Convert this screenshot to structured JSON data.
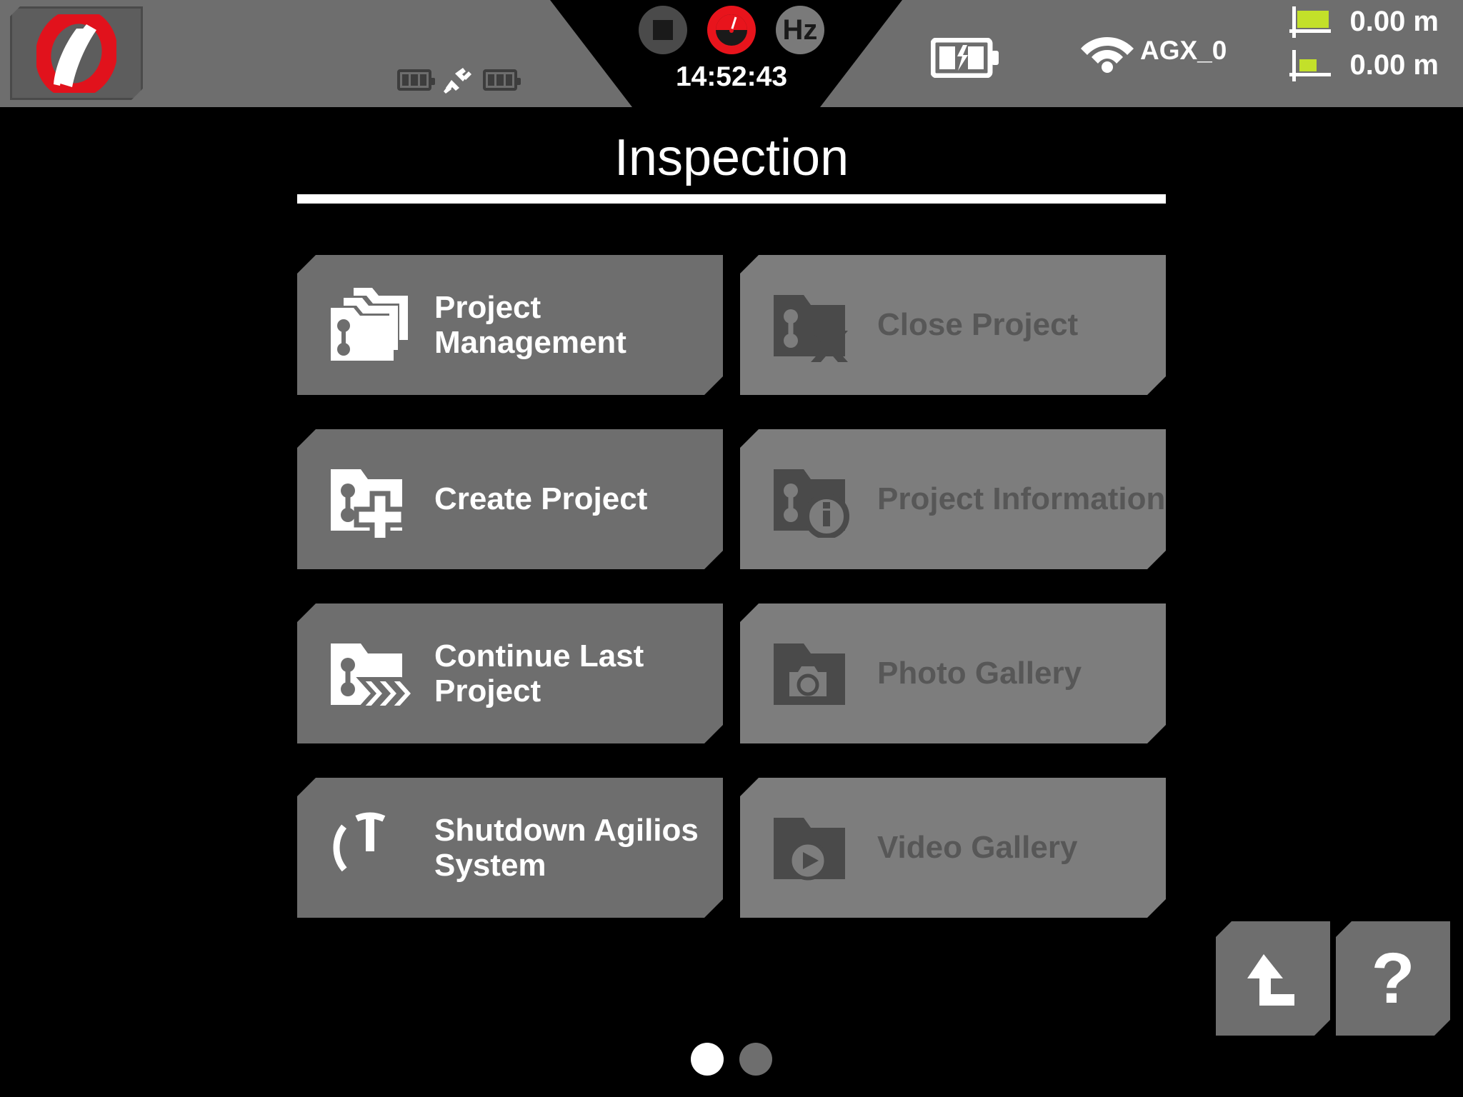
{
  "header": {
    "logo": {
      "name": "agilios-logo",
      "ring_color": "#e1121c",
      "swoosh_color": "#ffffff"
    },
    "left_batteries": [
      {
        "name": "battery-1",
        "label": "battery",
        "state": "idle"
      },
      {
        "name": "plug-disconnected",
        "label": "plug"
      },
      {
        "name": "battery-2",
        "label": "battery",
        "state": "idle"
      }
    ],
    "center": {
      "stop_label": "stop",
      "record_label": "record",
      "hz_label": "Hz",
      "clock": "14:52:43"
    },
    "charging_battery_label": "charging",
    "wifi": {
      "ssid": "AGX_0",
      "signal": "full"
    },
    "measurements": [
      {
        "name": "measurement-upper",
        "value": "0.00 m",
        "bar_color": "#c3e02a",
        "bar_width": "wide"
      },
      {
        "name": "measurement-lower",
        "value": "0.00 m",
        "bar_color": "#c3e02a",
        "bar_width": "narrow"
      }
    ]
  },
  "main": {
    "title": "Inspection",
    "tiles": [
      {
        "id": "project-management",
        "label": "Project Management",
        "icon": "folder-stack-path-icon",
        "enabled": true
      },
      {
        "id": "close-project",
        "label": "Close Project",
        "icon": "folder-path-x-icon",
        "enabled": false
      },
      {
        "id": "create-project",
        "label": "Create Project",
        "icon": "folder-path-plus-icon",
        "enabled": true
      },
      {
        "id": "project-information",
        "label": "Project Information",
        "icon": "folder-path-info-icon",
        "enabled": false
      },
      {
        "id": "continue-last-project",
        "label": "Continue Last Project",
        "icon": "folder-path-chevrons-icon",
        "enabled": true
      },
      {
        "id": "photo-gallery",
        "label": "Photo Gallery",
        "icon": "folder-camera-icon",
        "enabled": false
      },
      {
        "id": "shutdown-agilios-system",
        "label": "Shutdown Agilios System",
        "icon": "power-icon",
        "enabled": true
      },
      {
        "id": "video-gallery",
        "label": "Video Gallery",
        "icon": "folder-play-icon",
        "enabled": false
      }
    ]
  },
  "footer": {
    "back_button_label": "back",
    "help_button_label": "?",
    "pages": {
      "total": 2,
      "current": 1
    }
  },
  "colors": {
    "background": "#000000",
    "panel_gray": "#6e6e6e",
    "disabled_gray": "#7d7d7d",
    "disabled_fg": "#4a4a4a",
    "record_red": "#e8141c",
    "accent_green": "#c3e02a",
    "text_white": "#ffffff"
  }
}
